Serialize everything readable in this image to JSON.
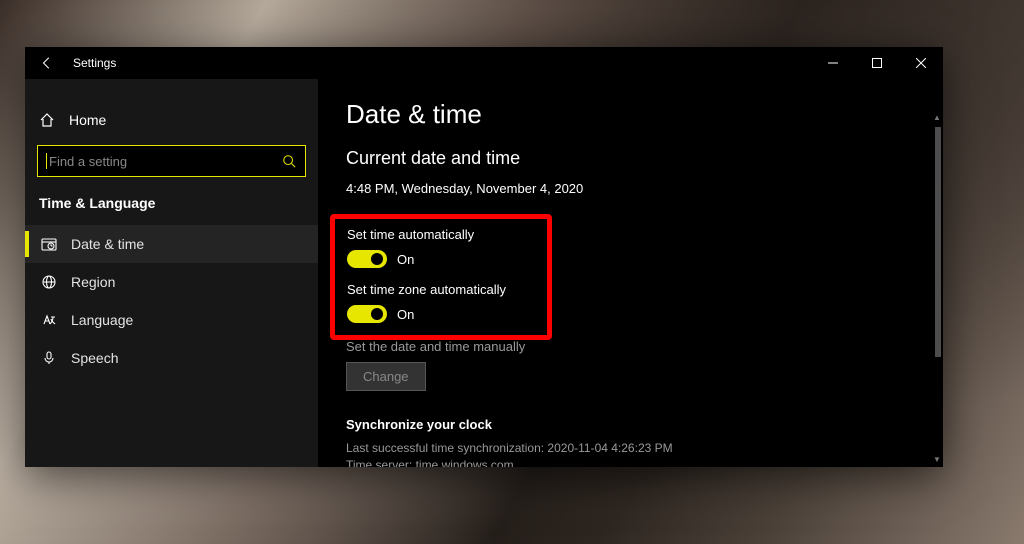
{
  "titlebar": {
    "title": "Settings"
  },
  "sidebar": {
    "home": "Home",
    "search_placeholder": "Find a setting",
    "section": "Time & Language",
    "items": [
      {
        "label": "Date & time",
        "icon": "clock",
        "active": true
      },
      {
        "label": "Region",
        "icon": "globe",
        "active": false
      },
      {
        "label": "Language",
        "icon": "language",
        "active": false
      },
      {
        "label": "Speech",
        "icon": "mic",
        "active": false
      }
    ]
  },
  "main": {
    "heading": "Date & time",
    "subheading": "Current date and time",
    "current": "4:48 PM, Wednesday, November 4, 2020",
    "toggle1": {
      "label": "Set time automatically",
      "state": "On"
    },
    "toggle2": {
      "label": "Set time zone automatically",
      "state": "On"
    },
    "manual_label": "Set the date and time manually",
    "change_btn": "Change",
    "sync": {
      "title": "Synchronize your clock",
      "line1": "Last successful time synchronization: 2020-11-04 4:26:23 PM",
      "line2": "Time server: time.windows.com"
    }
  }
}
